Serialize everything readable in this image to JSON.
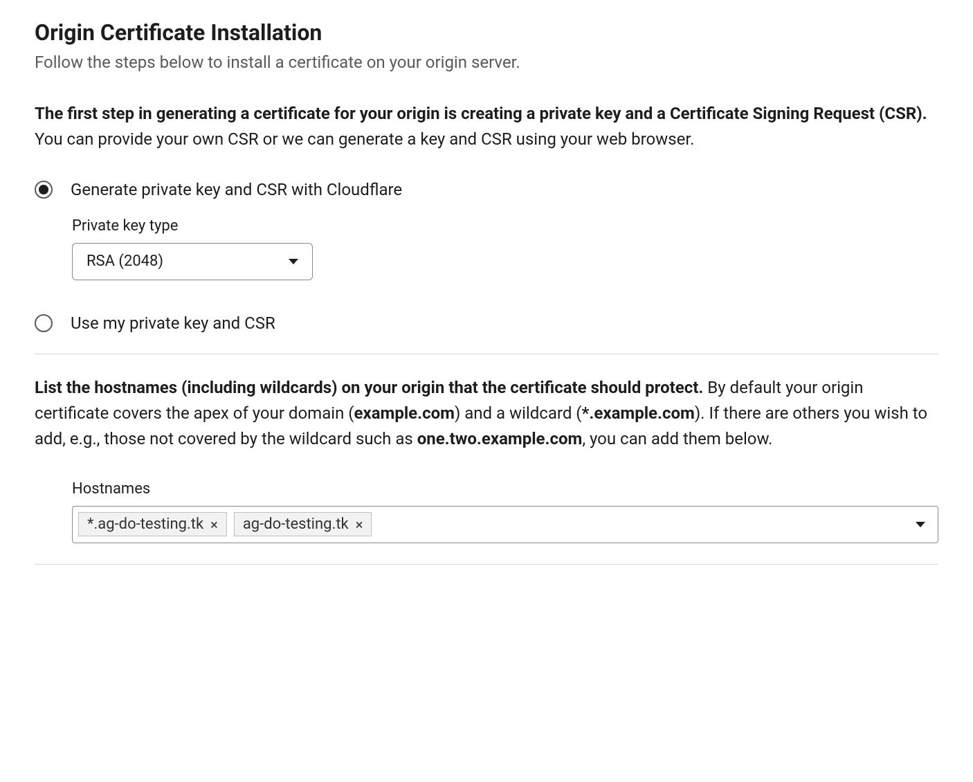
{
  "title": "Origin Certificate Installation",
  "subtitle": "Follow the steps below to install a certificate on your origin server.",
  "step1": {
    "bold": "The first step in generating a certificate for your origin is creating a private key and a Certificate Signing Request (CSR).",
    "rest": " You can provide your own CSR or we can generate a key and CSR using your web browser."
  },
  "radios": {
    "generate": {
      "label": "Generate private key and CSR with Cloudflare",
      "selected": true
    },
    "own": {
      "label": "Use my private key and CSR",
      "selected": false
    }
  },
  "keytype": {
    "label": "Private key type",
    "value": "RSA (2048)"
  },
  "step2": {
    "bold1": "List the hostnames (including wildcards) on your origin that the certificate should protect.",
    "text1": " By default your origin certificate covers the apex of your domain (",
    "bold2": "example.com",
    "text2": ") and a wildcard (",
    "bold3": "*.example.com",
    "text3": "). If there are others you wish to add, e.g., those not covered by the wildcard such as ",
    "bold4": "one.two.example.com",
    "text4": ", you can add them below."
  },
  "hostnames": {
    "label": "Hostnames",
    "tags": [
      "*.ag-do-testing.tk",
      "ag-do-testing.tk"
    ]
  }
}
